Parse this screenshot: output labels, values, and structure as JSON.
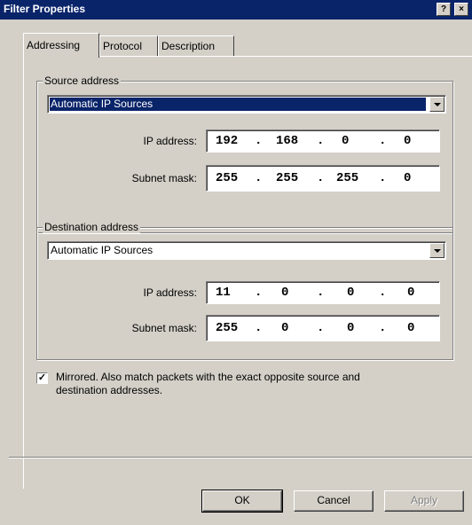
{
  "window": {
    "title": "Filter Properties",
    "help_btn": "?",
    "close_btn": "×"
  },
  "tabs": [
    {
      "label": "Addressing"
    },
    {
      "label": "Protocol"
    },
    {
      "label": "Description"
    }
  ],
  "source": {
    "group_label": "Source address",
    "combo_value": "Automatic IP Sources",
    "ip_label": "IP address:",
    "ip": [
      "192",
      "168",
      "0",
      "0"
    ],
    "mask_label": "Subnet mask:",
    "mask": [
      "255",
      "255",
      "255",
      "0"
    ]
  },
  "destination": {
    "group_label": "Destination address",
    "combo_value": "Automatic IP Sources",
    "ip_label": "IP address:",
    "ip": [
      "11",
      "0",
      "0",
      "0"
    ],
    "mask_label": "Subnet mask:",
    "mask": [
      "255",
      "0",
      "0",
      "0"
    ]
  },
  "mirrored": {
    "checked": true,
    "mark": "✓",
    "text_line1": "Mirrored. Also match packets with the exact opposite source and",
    "text_line2": "destination addresses."
  },
  "buttons": {
    "ok": "OK",
    "cancel": "Cancel",
    "apply": "Apply"
  },
  "ip_sep": "."
}
